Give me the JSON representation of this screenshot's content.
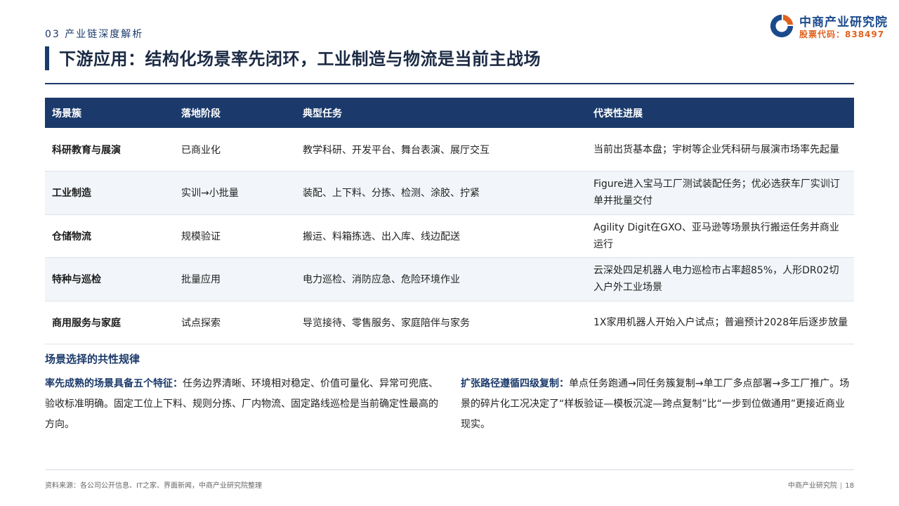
{
  "header": {
    "section_tag": "03 产业链深度解析",
    "logo_name": "中商产业研究院",
    "logo_code": "股票代码：838497"
  },
  "title": "下游应用：结构化场景率先闭环，工业制造与物流是当前主战场",
  "table": {
    "headers": [
      "场景簇",
      "落地阶段",
      "典型任务",
      "代表性进展"
    ],
    "rows": [
      {
        "scene": "科研教育与展演",
        "stage": "已商业化",
        "tasks": "教学科研、开发平台、舞台表演、展厅交互",
        "progress": "当前出货基本盘；宇树等企业凭科研与展演市场率先起量"
      },
      {
        "scene": "工业制造",
        "stage": "实训→小批量",
        "tasks": "装配、上下料、分拣、检测、涂胶、拧紧",
        "progress": "Figure进入宝马工厂测试装配任务；优必选获车厂实训订单并批量交付"
      },
      {
        "scene": "仓储物流",
        "stage": "规模验证",
        "tasks": "搬运、料箱拣选、出入库、线边配送",
        "progress": "Agility Digit在GXO、亚马逊等场景执行搬运任务并商业运行"
      },
      {
        "scene": "特种与巡检",
        "stage": "批量应用",
        "tasks": "电力巡检、消防应急、危险环境作业",
        "progress": "云深处四足机器人电力巡检市占率超85%，人形DR02切入户外工业场景"
      },
      {
        "scene": "商用服务与家庭",
        "stage": "试点探索",
        "tasks": "导览接待、零售服务、家庭陪伴与家务",
        "progress": "1X家用机器人开始入户试点；普遍预计2028年后逐步放量"
      }
    ]
  },
  "summary": {
    "heading": "场景选择的共性规律",
    "left_lead": "率先成熟的场景具备五个特征：",
    "left_body": "任务边界清晰、环境相对稳定、价值可量化、异常可兜底、验收标准明确。固定工位上下料、规则分拣、厂内物流、固定路线巡检是当前确定性最高的方向。",
    "right_lead": "扩张路径遵循四级复制：",
    "right_body": "单点任务跑通→同任务簇复制→单工厂多点部署→多工厂推广。场景的碎片化工况决定了“样板验证—模板沉淀—跨点复制”比“一步到位做通用”更接近商业现实。"
  },
  "footer": {
    "source": "资料来源：各公司公开信息、IT之家、界面新闻，中商产业研究院整理",
    "org": "中商产业研究院",
    "page": "18"
  },
  "colors": {
    "navy": "#1b3a6b",
    "logo_blue": "#1b4a8c",
    "logo_orange": "#e0621e",
    "row_alt": "#f2f5f9"
  },
  "icons": {
    "logo": "corporate-logo-mark"
  }
}
